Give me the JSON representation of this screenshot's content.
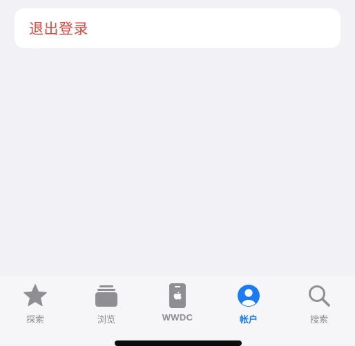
{
  "logout": {
    "label": "退出登录"
  },
  "tab_bar": {
    "active_color": "#1a7cf5",
    "inactive_color": "#8e8e93",
    "tabs": [
      {
        "label": "探索",
        "icon": "star-icon",
        "active": false
      },
      {
        "label": "浏览",
        "icon": "stacked-cards-icon",
        "active": false
      },
      {
        "label": "WWDC",
        "icon": "apple-device-icon",
        "active": false
      },
      {
        "label": "帐户",
        "icon": "person-circle-icon",
        "active": true
      },
      {
        "label": "搜索",
        "icon": "magnifying-glass-icon",
        "active": false
      }
    ]
  },
  "colors": {
    "background": "#f2f1f6",
    "destructive": "#e0473b"
  }
}
